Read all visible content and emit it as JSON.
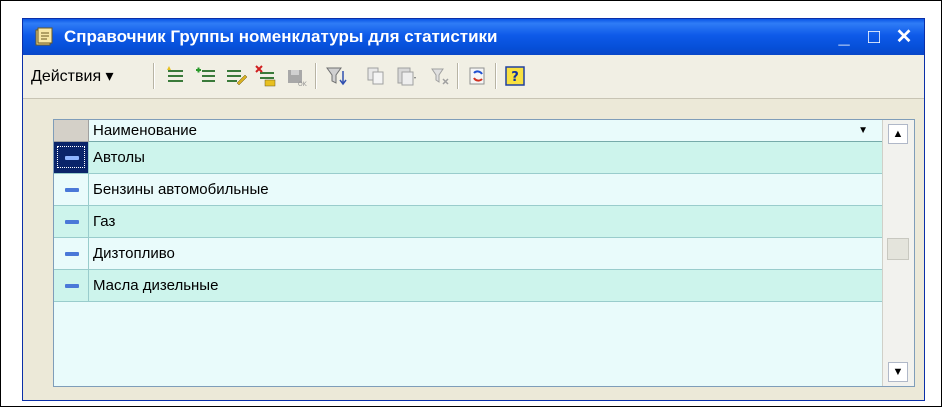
{
  "window": {
    "title": "Справочник Группы номенклатуры для статистики",
    "minimize_glyph": "_",
    "maximize_glyph": "□",
    "close_glyph": "✕"
  },
  "toolbar": {
    "actions_label": "Действия ▾",
    "icons": [
      "add-item-icon",
      "add-group-icon",
      "edit-icon",
      "delete-icon",
      "save-icon",
      "filter-icon",
      "copy-icon",
      "paste-icon",
      "clear-filter-icon",
      "refresh-icon",
      "help-icon"
    ]
  },
  "grid": {
    "column_header": "Наименование",
    "sort_glyph": "▼",
    "rows": [
      {
        "label": "Автолы"
      },
      {
        "label": "Бензины автомобильные"
      },
      {
        "label": "Газ"
      },
      {
        "label": "Дизтопливо"
      },
      {
        "label": "Масла дизельные"
      }
    ],
    "scroll_up_glyph": "▲",
    "scroll_down_glyph": "▼"
  },
  "colors": {
    "titlebar": "#0a55e6",
    "row_odd": "#cdf4ec",
    "row_even": "#e9fbfb",
    "selection": "#0a246a"
  }
}
